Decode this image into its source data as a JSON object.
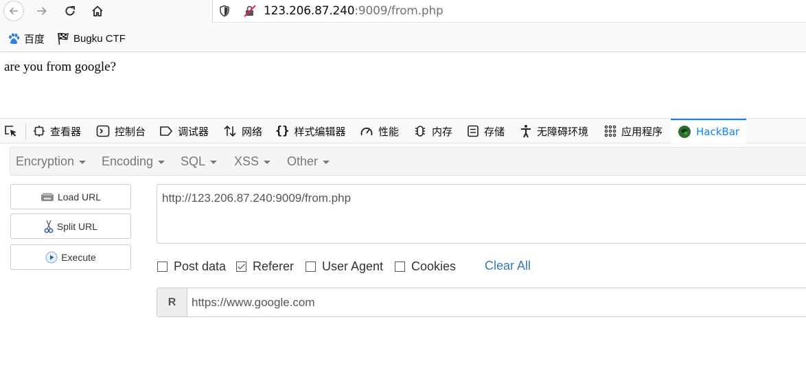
{
  "browser": {
    "url_host": "123.206.87.240",
    "url_rest": ":9009/from.php"
  },
  "bookmarks": [
    {
      "label": "百度",
      "icon": "paw-icon"
    },
    {
      "label": "Bugku CTF",
      "icon": "checkered-flag-icon"
    }
  ],
  "page": {
    "text": "are you from google?"
  },
  "devtools": {
    "tabs": [
      {
        "label": "查看器",
        "icon": "inspector-icon"
      },
      {
        "label": "控制台",
        "icon": "console-icon"
      },
      {
        "label": "调试器",
        "icon": "debugger-icon"
      },
      {
        "label": "网络",
        "icon": "network-icon"
      },
      {
        "label": "样式编辑器",
        "icon": "style-editor-icon"
      },
      {
        "label": "性能",
        "icon": "performance-icon"
      },
      {
        "label": "内存",
        "icon": "memory-icon"
      },
      {
        "label": "存储",
        "icon": "storage-icon"
      },
      {
        "label": "无障碍环境",
        "icon": "accessibility-icon"
      },
      {
        "label": "应用程序",
        "icon": "application-icon"
      },
      {
        "label": "HackBar",
        "icon": "hackbar-icon",
        "active": true
      }
    ],
    "active_color": "#0a84ff"
  },
  "hackbar": {
    "menu": [
      "Encryption",
      "Encoding",
      "SQL",
      "XSS",
      "Other"
    ],
    "buttons": {
      "load_url": "Load URL",
      "split_url": "Split URL",
      "execute": "Execute"
    },
    "url_value": "http://123.206.87.240:9009/from.php",
    "options": [
      {
        "label": "Post data",
        "checked": false
      },
      {
        "label": "Referer",
        "checked": true
      },
      {
        "label": "User Agent",
        "checked": false
      },
      {
        "label": "Cookies",
        "checked": false
      }
    ],
    "clear_all": "Clear All",
    "referer": {
      "addon": "R",
      "value": "https://www.google.com"
    },
    "link_color": "#337ab7"
  }
}
